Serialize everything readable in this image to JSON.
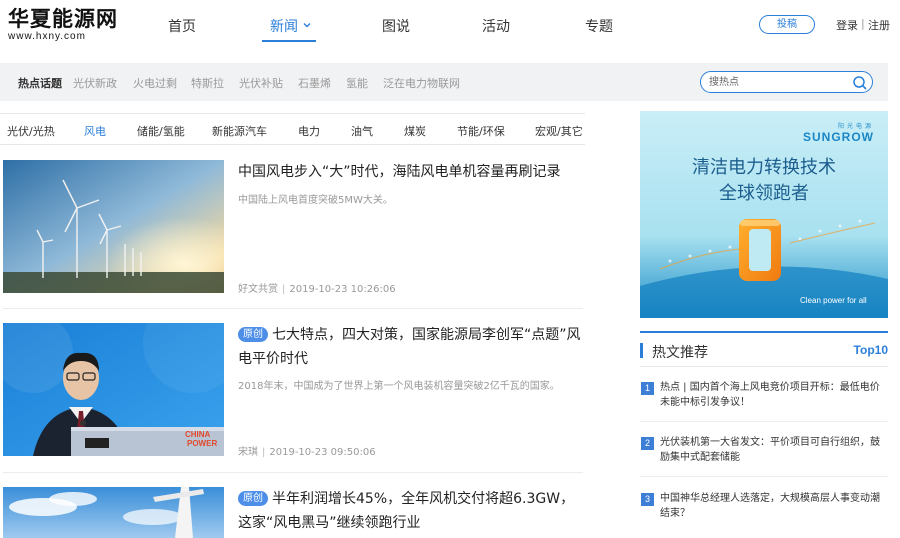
{
  "logo": {
    "name_cn": "华夏能源网",
    "domain": "www.hxny.com"
  },
  "nav": {
    "items": [
      {
        "label": "首页"
      },
      {
        "label": "新闻"
      },
      {
        "label": "图说"
      },
      {
        "label": "活动"
      },
      {
        "label": "专题"
      }
    ],
    "active": "新闻",
    "submit_label": "投稿",
    "login_label": "登录",
    "register_label": "注册"
  },
  "hotbar": {
    "title": "热点话题",
    "items": [
      "光伏新政",
      "火电过剩",
      "特斯拉",
      "光伏补贴",
      "石墨烯",
      "氢能",
      "泛在电力物联网"
    ],
    "search_placeholder": "搜热点"
  },
  "categories": {
    "items": [
      "光伏/光热",
      "风电",
      "储能/氢能",
      "新能源汽车",
      "电力",
      "油气",
      "煤炭",
      "节能/环保",
      "宏观/其它"
    ],
    "active": "风电"
  },
  "articles": [
    {
      "title": "中国风电步入“大”时代，海陆风电单机容量再刷记录",
      "summary": "中国陆上风电首度突破5MW大关。",
      "author": "好文共赏",
      "date": "2019-10-23 10:26:06",
      "badge": ""
    },
    {
      "title": "七大特点，四大对策，国家能源局李创军“点题”风电平价时代",
      "summary": "2018年末，中国成为了世界上第一个风电装机容量突破2亿千瓦的国家。",
      "author": "宋琪",
      "date": "2019-10-23 09:50:06",
      "badge": "原创"
    },
    {
      "title": "半年利润增长45%，全年风机交付将超6.3GW，这家“风电黑马”继续领跑行业",
      "summary": "",
      "author": "",
      "date": "",
      "badge": "原创"
    }
  ],
  "ad": {
    "brand_small": "阳光电源",
    "brand": "SUNGROW",
    "headline_1": "清洁电力转换技术",
    "headline_2": "全球领跑者",
    "tagline": "Clean power for all",
    "color": "#bfeaf4"
  },
  "recommend": {
    "title": "热文推荐",
    "top_label": "Top10",
    "items": [
      {
        "num": "1",
        "text": "热点 | 国内首个海上风电竞价项目开标：最低电价未能中标引发争议！"
      },
      {
        "num": "2",
        "text": "光伏装机第一大省发文：平价项目可自行组织，鼓励集中式配套储能"
      },
      {
        "num": "3",
        "text": "中国神华总经理人选落定，大规模高层人事变动潮结束？"
      }
    ]
  },
  "colors": {
    "accent": "#2b7fd9",
    "badge": "#4d8fe8"
  }
}
